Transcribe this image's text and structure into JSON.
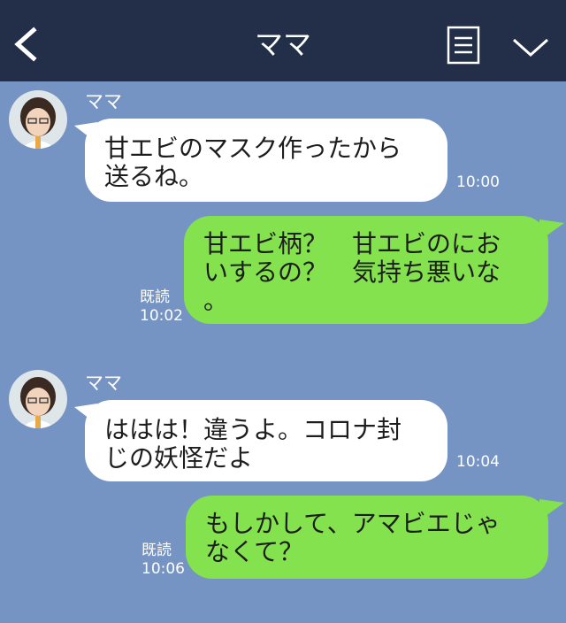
{
  "header": {
    "title": "ママ",
    "back_icon": "chevron-left-icon",
    "menu_icon": "menu-lines-icon",
    "collapse_icon": "chevron-down-icon",
    "background": "#232e48"
  },
  "chat": {
    "background": "#7594c4",
    "incoming_bubble_color": "#ffffff",
    "outgoing_bubble_color": "#84e24f",
    "messages": [
      {
        "direction": "incoming",
        "sender": "ママ",
        "text": "甘エビのマスク作ったから\n送るね。",
        "time": "10:00"
      },
      {
        "direction": "outgoing",
        "text": "甘エビ柄？　甘エビのにお\nいするの？　気持ち悪いな\n。",
        "read_label": "既読",
        "time": "10:02"
      },
      {
        "direction": "incoming",
        "sender": "ママ",
        "text": "ははは！違うよ。コロナ封\nじの妖怪だよ",
        "time": "10:04"
      },
      {
        "direction": "outgoing",
        "text": "もしかして、アマビエじゃ\nなくて？",
        "read_label": "既読",
        "time": "10:06"
      }
    ]
  }
}
